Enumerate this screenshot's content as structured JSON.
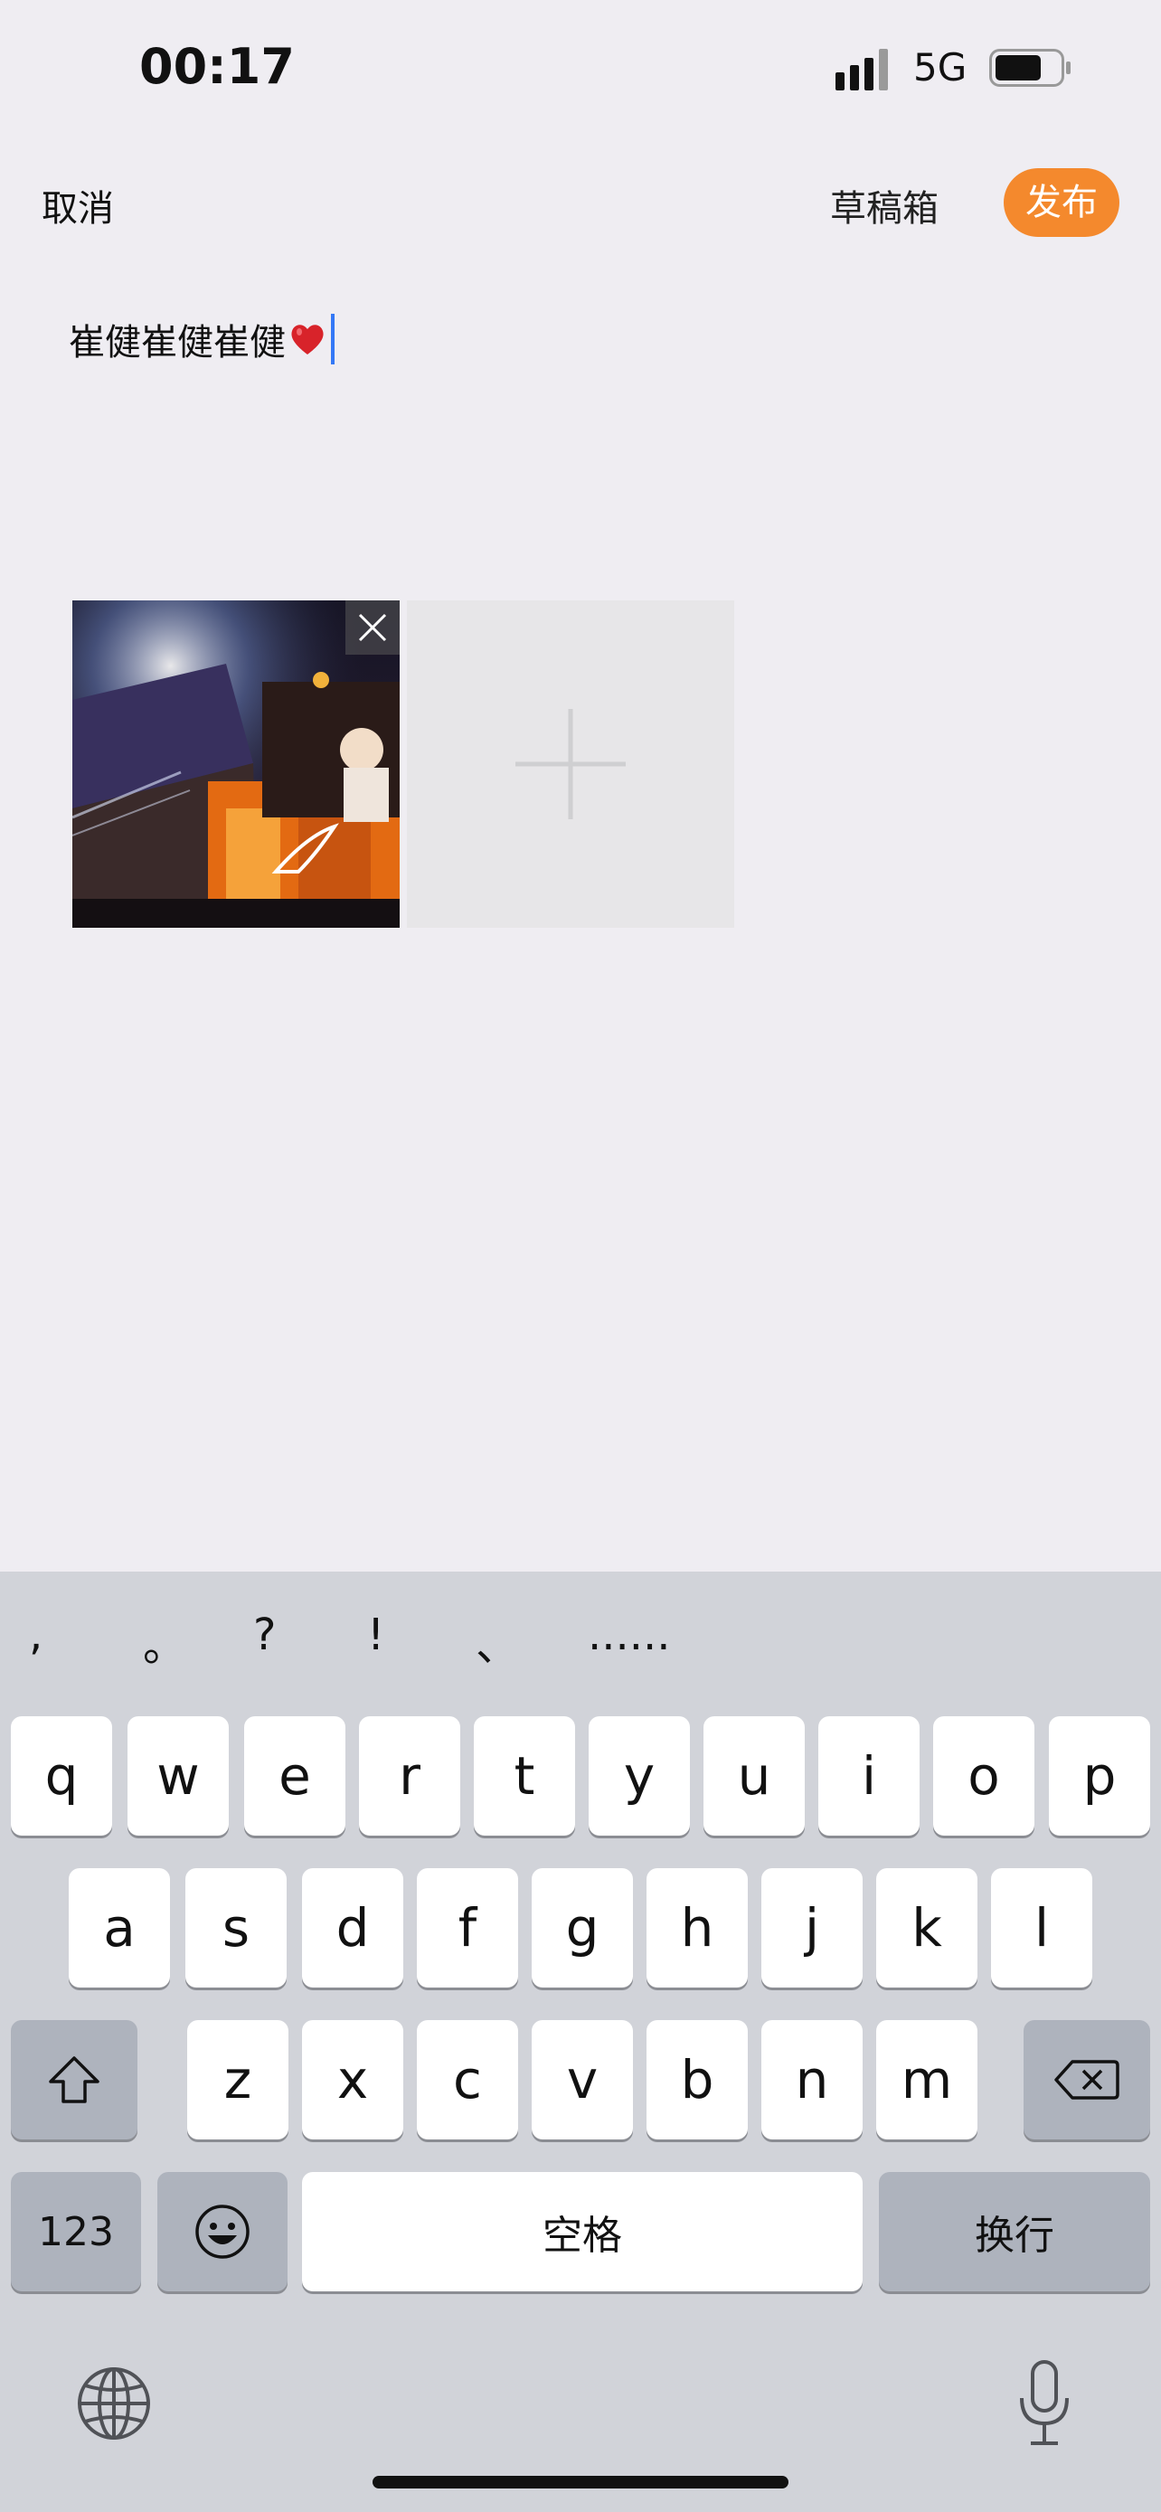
{
  "status_bar": {
    "time": "00:17",
    "network": "5G"
  },
  "nav": {
    "cancel": "取消",
    "drafts": "草稿箱",
    "publish": "发布"
  },
  "editor": {
    "text": "崔健崔健崔健"
  },
  "keyboard": {
    "punctuation": [
      ",",
      "。",
      "?",
      "!",
      "、",
      "......"
    ],
    "row1": [
      "q",
      "w",
      "e",
      "r",
      "t",
      "y",
      "u",
      "i",
      "o",
      "p"
    ],
    "row2": [
      "a",
      "s",
      "d",
      "f",
      "g",
      "h",
      "j",
      "k",
      "l"
    ],
    "row3": [
      "z",
      "x",
      "c",
      "v",
      "b",
      "n",
      "m"
    ],
    "numbers": "123",
    "space": "空格",
    "return": "换行"
  },
  "colors": {
    "accent": "#f4892d",
    "cursor": "#3478f6",
    "background": "#efedf2",
    "keyboard": "#d1d3d9"
  }
}
